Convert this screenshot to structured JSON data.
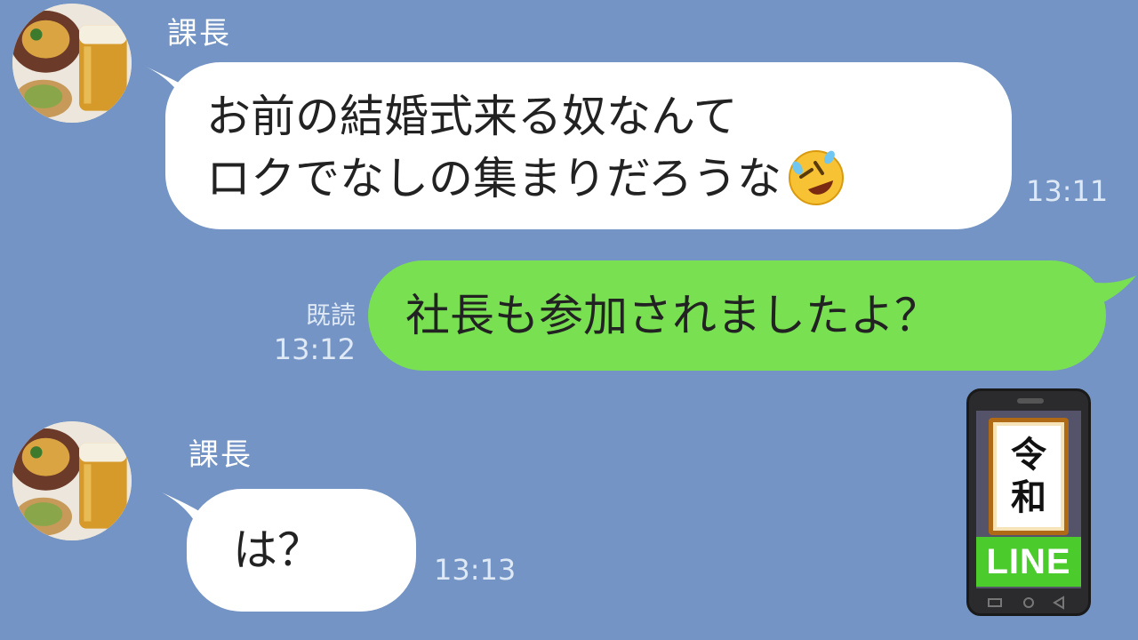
{
  "messages": [
    {
      "sender": "課長",
      "lines": [
        "お前の結婚式来る奴なんて",
        "ロクでなしの集まりだろうな"
      ],
      "emoji": "rolling-on-floor-laughing-emoji",
      "time": "13:11"
    },
    {
      "text": "社長も参加されましたよ？",
      "read_label": "既読",
      "time": "13:12"
    },
    {
      "sender": "課長",
      "text": "は？",
      "time": "13:13"
    }
  ],
  "badge": {
    "kanji_top": "令",
    "kanji_bottom": "和",
    "line_label": "LINE"
  },
  "colors": {
    "background": "#7394c4",
    "incoming_bubble": "#ffffff",
    "outgoing_bubble": "#79e052",
    "badge_green": "#4ccc2c"
  }
}
